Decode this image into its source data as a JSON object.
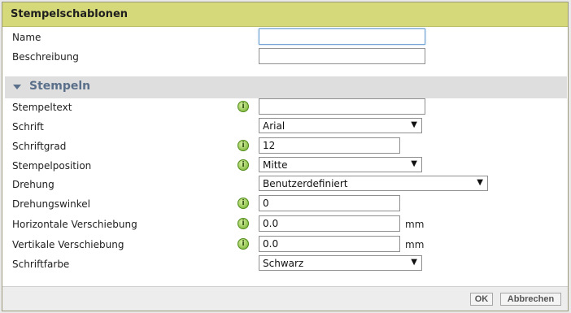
{
  "dialog": {
    "title": "Stempelschablonen"
  },
  "fields": {
    "name_label": "Name",
    "name_value": "",
    "desc_label": "Beschreibung",
    "desc_value": ""
  },
  "section": {
    "title": "Stempeln"
  },
  "stamp": {
    "text_label": "Stempeltext",
    "text_value": "",
    "font_label": "Schrift",
    "font_value": "Arial",
    "size_label": "Schriftgrad",
    "size_value": "12",
    "position_label": "Stempelposition",
    "position_value": "Mitte",
    "rotation_label": "Drehung",
    "rotation_value": "Benutzerdefiniert",
    "angle_label": "Drehungswinkel",
    "angle_value": "0",
    "hshift_label": "Horizontale Verschiebung",
    "hshift_value": "0.0",
    "hshift_unit": "mm",
    "vshift_label": "Vertikale Verschiebung",
    "vshift_value": "0.0",
    "vshift_unit": "mm",
    "color_label": "Schriftfarbe",
    "color_value": "Schwarz"
  },
  "icons": {
    "info": "info-icon",
    "dropdown": "chevron-down-icon",
    "collapse": "triangle-down-icon"
  },
  "footer": {
    "ok_label": "OK",
    "cancel_label": "Abbrechen"
  },
  "colors": {
    "titlebar": "#d6d97a",
    "section_text": "#5a6f8a",
    "info_icon": "#6fae2c"
  }
}
